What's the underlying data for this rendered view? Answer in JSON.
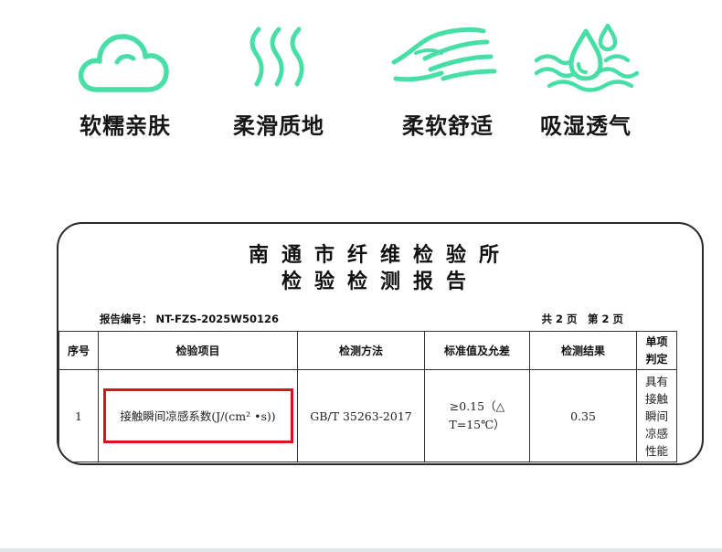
{
  "features": [
    {
      "icon": "cloud-icon",
      "label": "软糯亲肤"
    },
    {
      "icon": "steam-waves-icon",
      "label": "柔滑质地"
    },
    {
      "icon": "hand-icon",
      "label": "柔软舒适"
    },
    {
      "icon": "water-drops-icon",
      "label": "吸湿透气"
    }
  ],
  "report": {
    "title_line1": "南通市纤维检验所",
    "title_line2": "检验检测报告",
    "report_no": "报告编号： NT-FZS-2025W50126",
    "pages": "共 2 页　第 2 页",
    "headers": {
      "no": "序号",
      "item": "检验项目",
      "method": "检测方法",
      "standard": "标准值及允差",
      "result": "检测结果",
      "verdict_1": "单项",
      "verdict_2": "判定"
    },
    "row": {
      "no": "1",
      "item": "接触瞬间凉感系数(J/(cm² •s))",
      "method": "GB/T 35263-2017",
      "standard_1": "≥0.15（△",
      "standard_2": "T=15℃）",
      "result": "0.35",
      "verdict": [
        "具有",
        "接触",
        "瞬间",
        "凉感",
        "性能"
      ]
    }
  },
  "colors": {
    "icon_mint": "#48dea8",
    "highlight": "#d9141b"
  }
}
